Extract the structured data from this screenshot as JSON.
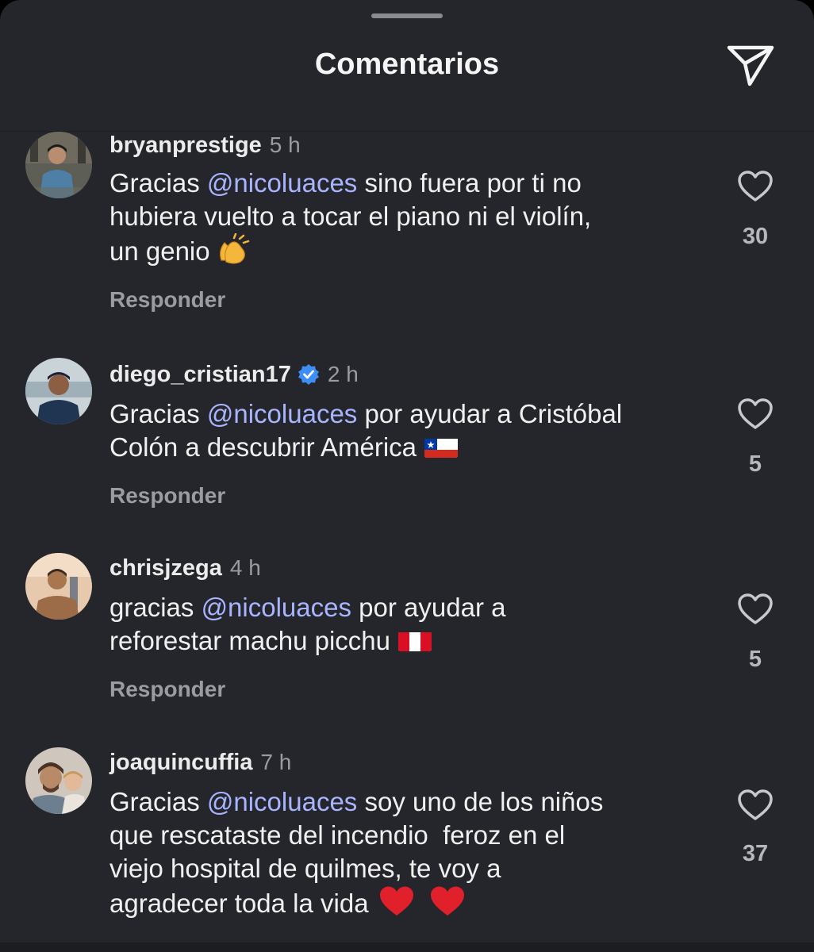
{
  "header": {
    "title": "Comentarios",
    "share_icon": "send-icon"
  },
  "colors": {
    "background": "#25262b",
    "mention": "#a9b4ff",
    "muted_text": "#9b9ca2",
    "verified": "#3d8ef7",
    "heart_emoji": "#e0202a"
  },
  "comments": [
    {
      "username": "bryanprestige",
      "verified": false,
      "time": "5 h",
      "text_before": "Gracias ",
      "mention": "@nicoluaces",
      "text_after": " sino fuera por ti no\nhubiera vuelto a tocar el piano ni el violín,\nun genio",
      "emoji": "clapping-hands",
      "reply_label": "Responder",
      "likes": "30"
    },
    {
      "username": "diego_cristian17",
      "verified": true,
      "time": "2 h",
      "text_before": "Gracias ",
      "mention": "@nicoluaces",
      "text_after": " por ayudar a Cristóbal\nColón a descubrir América",
      "emoji": "flag-chile",
      "reply_label": "Responder",
      "likes": "5"
    },
    {
      "username": "chrisjzega",
      "verified": false,
      "time": "4 h",
      "text_before": "gracias ",
      "mention": "@nicoluaces",
      "text_after": " por ayudar a\nreforestar machu picchu",
      "emoji": "flag-peru",
      "reply_label": "Responder",
      "likes": "5"
    },
    {
      "username": "joaquincuffia",
      "verified": false,
      "time": "7 h",
      "text_before": "Gracias ",
      "mention": "@nicoluaces",
      "text_after": " soy uno de los niños\nque rescataste del incendio  feroz en el\nviejo hospital de quilmes, te voy a\nagradecer toda la vida",
      "emoji": "red-heart red-heart",
      "reply_label": "Responder",
      "likes": "37"
    }
  ]
}
